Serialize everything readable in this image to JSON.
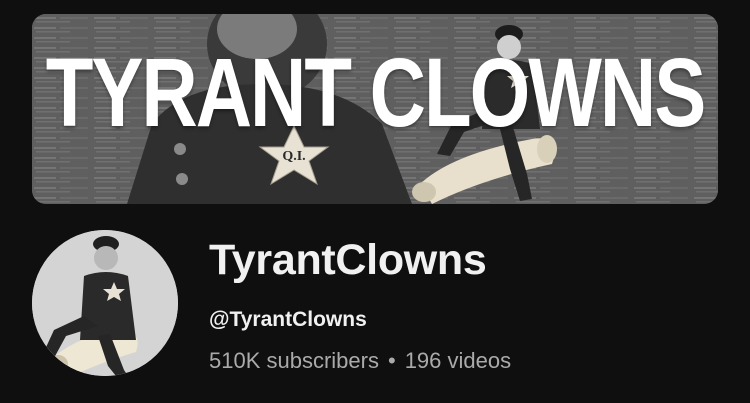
{
  "banner": {
    "title": "TYRANT CLOWNS",
    "badge_text": "Q.I."
  },
  "channel": {
    "name": "TyrantClowns",
    "handle": "@TyrantClowns",
    "subscribers": "510K subscribers",
    "separator": "•",
    "videos": "196 videos"
  },
  "icons": [
    "sheriff-star-icon"
  ],
  "colors": {
    "background": "#0f0f0f",
    "primary_text": "#f1f1f1",
    "secondary_text": "#aaaaaa"
  }
}
